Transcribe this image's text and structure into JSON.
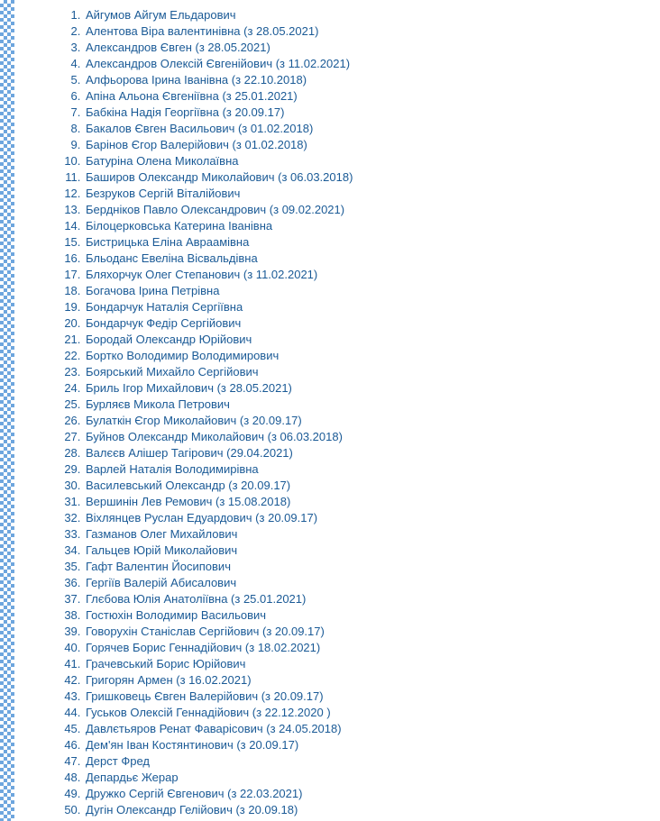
{
  "list": {
    "items": [
      "Айгумов Айгум Ельдарович",
      "Алентова Віра валентинівна (з 28.05.2021)",
      "Александров Євген (з 28.05.2021)",
      "Александров Олексій Євгенійович (з 11.02.2021)",
      "Алфьорова Ірина Іванівна (з 22.10.2018)",
      "Апіна Альона Євгеніївна (з 25.01.2021)",
      "Бабкіна Надія Георгіївна (з 20.09.17)",
      "Бакалов Євген Васильович (з 01.02.2018)",
      "Барінов Єгор Валерійович (з 01.02.2018)",
      "Батуріна Олена Миколаївна",
      "Баширов Олександр Миколайович (з 06.03.2018)",
      "Безруков Сергій Віталійович",
      "Бердніков Павло Олександрович (з 09.02.2021)",
      "Білоцерковська Катерина Іванівна",
      "Бистрицька Еліна Авраамівна",
      "Бльоданс Евеліна Вісвальдівна",
      "Бляхорчук Олег Степанович (з 11.02.2021)",
      "Богачова Ірина Петрівна",
      "Бондарчук Наталія Сергіївна",
      "Бондарчук Федір Сергійович",
      "Бородай Олександр Юрійович",
      "Бортко Володимир Володимирович",
      "Боярський Михайло Сергійович",
      "Бриль Ігор Михайлович (з 28.05.2021)",
      "Бурляєв Микола Петрович",
      "Булаткін Єгор Миколайович (з 20.09.17)",
      "Буйнов Олександр Миколайович (з 06.03.2018)",
      "Валєєв Алішер Тагірович (29.04.2021)",
      "Варлей Наталія Володимирівна",
      "Василевський Олександр (з 20.09.17)",
      "Вершинін Лев Ремович (з 15.08.2018)",
      "Віхлянцев Руслан Едуардович (з 20.09.17)",
      "Газманов Олег Михайлович",
      "Гальцев Юрій Миколайович",
      "Гафт Валентин Йосипович",
      "Гергіїв Валерій Абисалович",
      "Глєбова Юлія Анатоліївна (з 25.01.2021)",
      "Гостюхін Володимир Васильович",
      "Говорухін Станіслав Сергійович (з 20.09.17)",
      "Горячев Борис Геннадійович (з 18.02.2021)",
      "Грачевський Борис Юрійович",
      "Григорян Армен (з 16.02.2021)",
      "Гришковець Євген Валерійович (з 20.09.17)",
      "Гуськов Олексій Геннадійович (з 22.12.2020 )",
      "Давлєтьяров Ренат Фаварісович (з 24.05.2018)",
      "Дем'ян Іван Костянтинович (з 20.09.17)",
      "Дерст Фред",
      "Депардьє Жерар",
      "Дружко Сергій Євгенович (з 22.03.2021)",
      "Дугін Олександр Гелійович (з 20.09.18)"
    ]
  }
}
